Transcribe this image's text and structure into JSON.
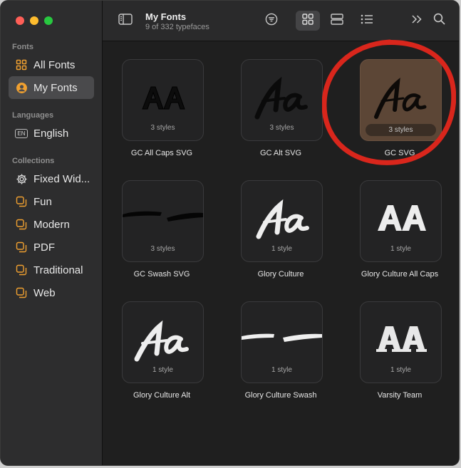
{
  "window": {
    "title": "My Fonts",
    "subtitle": "9 of 332 typefaces"
  },
  "sidebar": {
    "sections": {
      "fonts": "Fonts",
      "languages": "Languages",
      "collections": "Collections"
    },
    "fonts_items": [
      {
        "label": "All Fonts",
        "icon": "grid-icon"
      },
      {
        "label": "My Fonts",
        "icon": "person-circle-icon",
        "active": true
      }
    ],
    "language_items": [
      {
        "label": "English",
        "badge": "EN"
      }
    ],
    "collection_items": [
      {
        "label": "Fixed Wid...",
        "icon": "gear-icon"
      },
      {
        "label": "Fun",
        "icon": "collection-icon"
      },
      {
        "label": "Modern",
        "icon": "collection-icon"
      },
      {
        "label": "PDF",
        "icon": "collection-icon"
      },
      {
        "label": "Traditional",
        "icon": "collection-icon"
      },
      {
        "label": "Web",
        "icon": "collection-icon"
      }
    ]
  },
  "toolbar": {
    "view_mode": "grid",
    "buttons": [
      "sidebar-toggle-icon",
      "filter-icon",
      "grid-view-icon",
      "sample-view-icon",
      "list-view-icon",
      "chevron-more-icon",
      "search-icon"
    ]
  },
  "fonts": [
    {
      "name": "GC All Caps SVG",
      "styles": "3 styles",
      "preview": "AA"
    },
    {
      "name": "GC Alt SVG",
      "styles": "3 styles",
      "preview": "Aa"
    },
    {
      "name": "GC SVG",
      "styles": "3 styles",
      "preview": "Aa",
      "selected": true
    },
    {
      "name": "GC Swash SVG",
      "styles": "3 styles",
      "preview": "swash"
    },
    {
      "name": "Glory Culture",
      "styles": "1 style",
      "preview": "Aa"
    },
    {
      "name": "Glory Culture All Caps",
      "styles": "1 style",
      "preview": "AA"
    },
    {
      "name": "Glory Culture Alt",
      "styles": "1 style",
      "preview": "Aa"
    },
    {
      "name": "Glory Culture Swash",
      "styles": "1 style",
      "preview": "swash"
    },
    {
      "name": "Varsity Team",
      "styles": "1 style",
      "preview": "AA"
    }
  ],
  "colors": {
    "accent": "#f0a030",
    "selection_card": "#5c4636",
    "annotation_circle": "#d9261c"
  }
}
